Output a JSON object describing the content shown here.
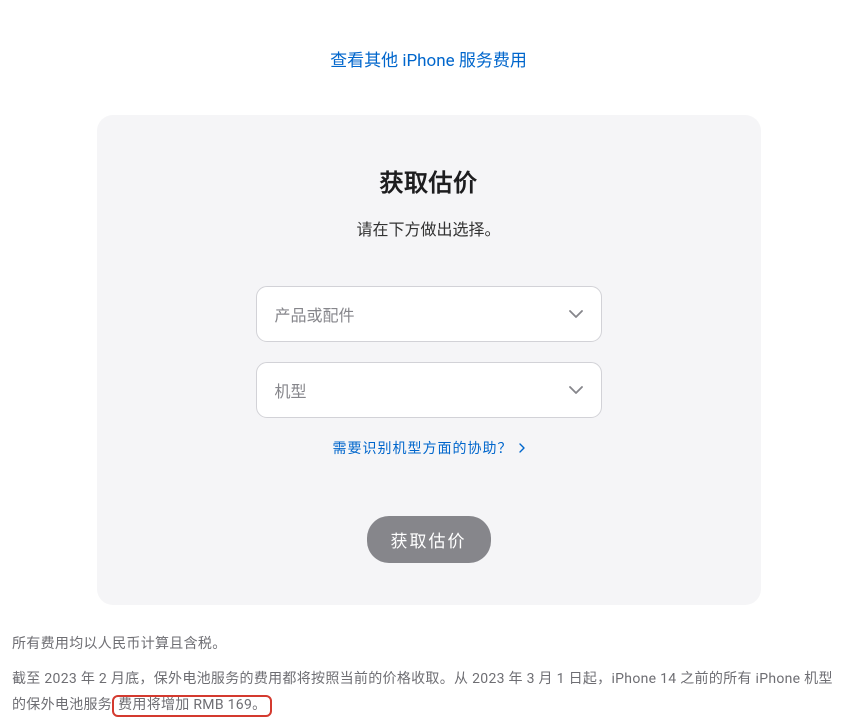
{
  "topLink": "查看其他 iPhone 服务费用",
  "card": {
    "title": "获取估价",
    "subtitle": "请在下方做出选择。",
    "select1": {
      "placeholder": "产品或配件"
    },
    "select2": {
      "placeholder": "机型"
    },
    "helpLink": "需要识别机型方面的协助？",
    "submit": "获取估价"
  },
  "footer": {
    "line1": "所有费用均以人民币计算且含税。",
    "line2a": "截至 2023 年 2 月底，保外电池服务的费用都将按照当前的价格收取。从 2023 年 3 月 1 日起，iPhone 14 之前的所有 iPhone 机型的保外电池服务",
    "line2b": "费用将增加 RMB 169。"
  }
}
